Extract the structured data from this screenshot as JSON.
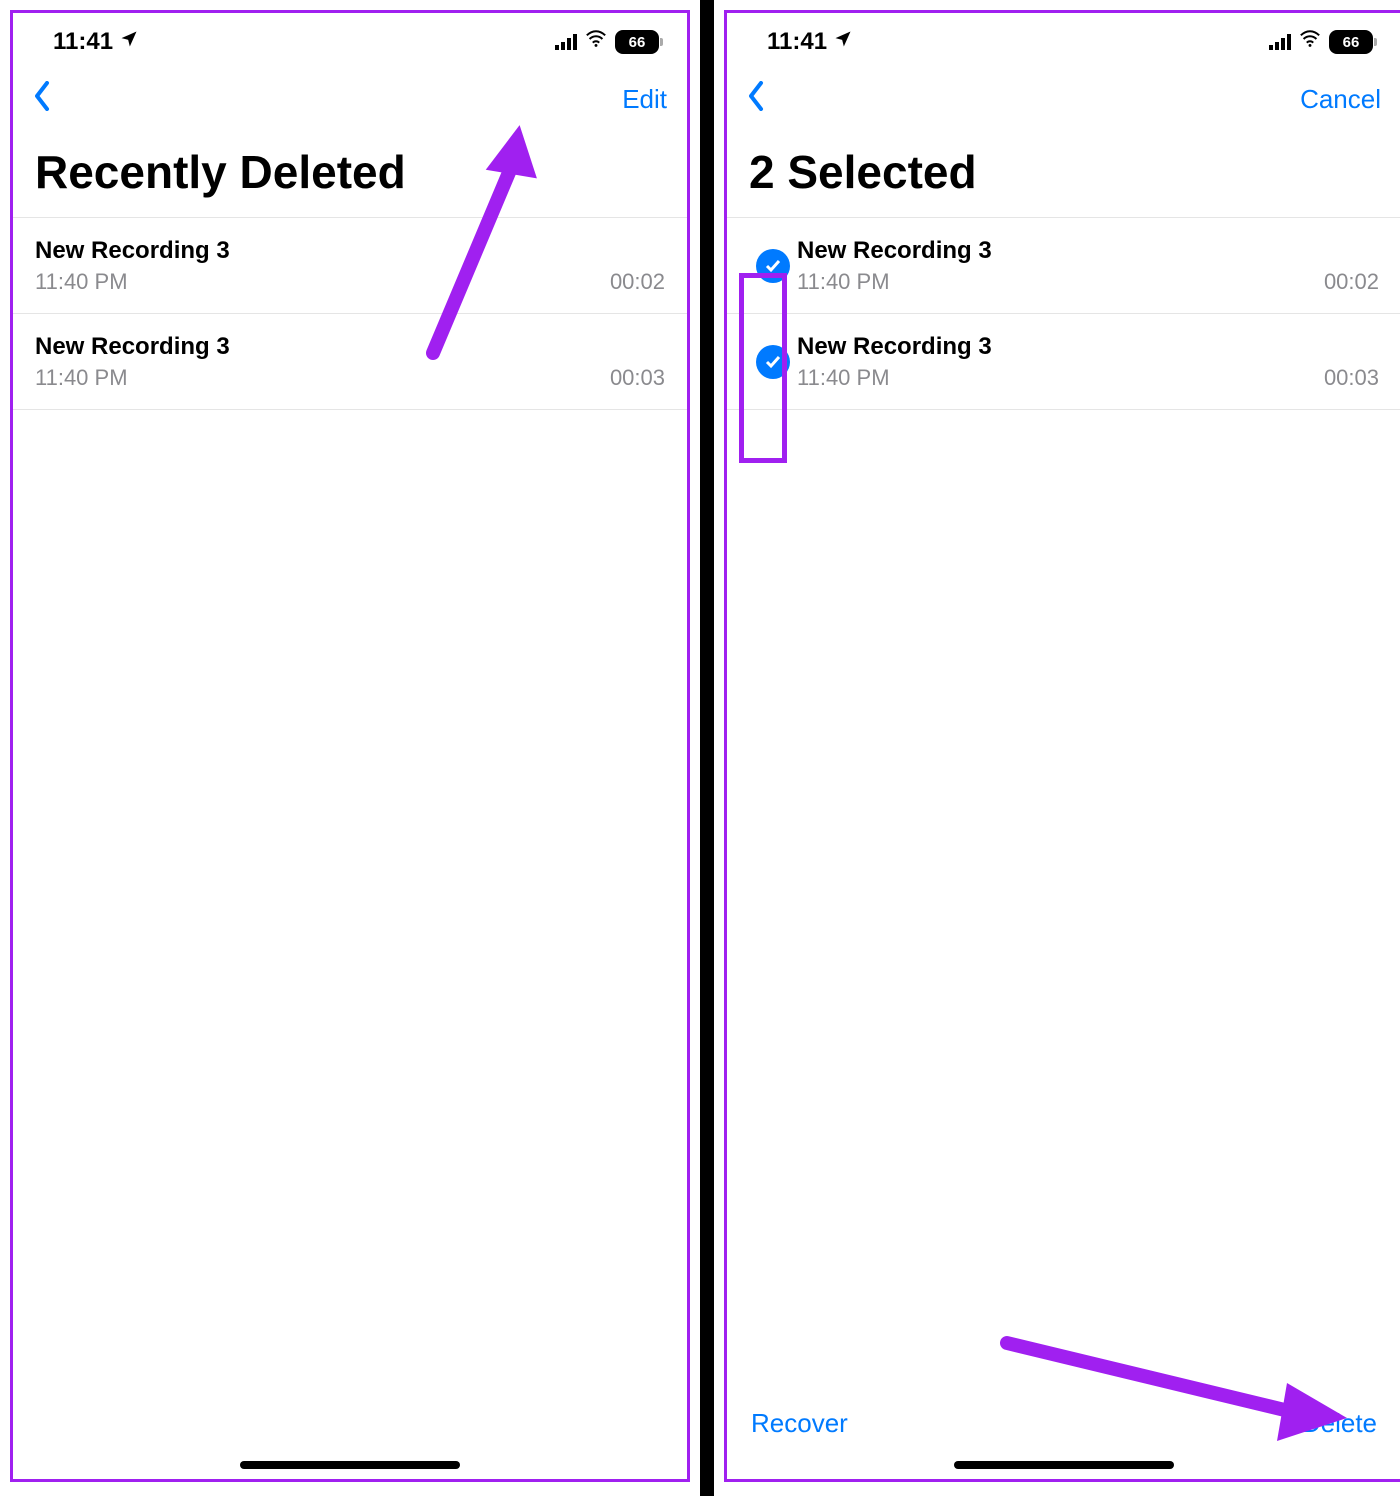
{
  "colors": {
    "accent": "#007aff",
    "annotation": "#a020f0"
  },
  "status": {
    "time": "11:41",
    "battery": "66"
  },
  "left": {
    "nav": {
      "edit": "Edit"
    },
    "title": "Recently Deleted",
    "rows": [
      {
        "title": "New Recording 3",
        "time": "11:40 PM",
        "duration": "00:02"
      },
      {
        "title": "New Recording 3",
        "time": "11:40 PM",
        "duration": "00:03"
      }
    ]
  },
  "right": {
    "nav": {
      "cancel": "Cancel"
    },
    "title": "2 Selected",
    "rows": [
      {
        "title": "New Recording 3",
        "time": "11:40 PM",
        "duration": "00:02"
      },
      {
        "title": "New Recording 3",
        "time": "11:40 PM",
        "duration": "00:03"
      }
    ],
    "bottom": {
      "recover": "Recover",
      "delete": "Delete"
    }
  }
}
